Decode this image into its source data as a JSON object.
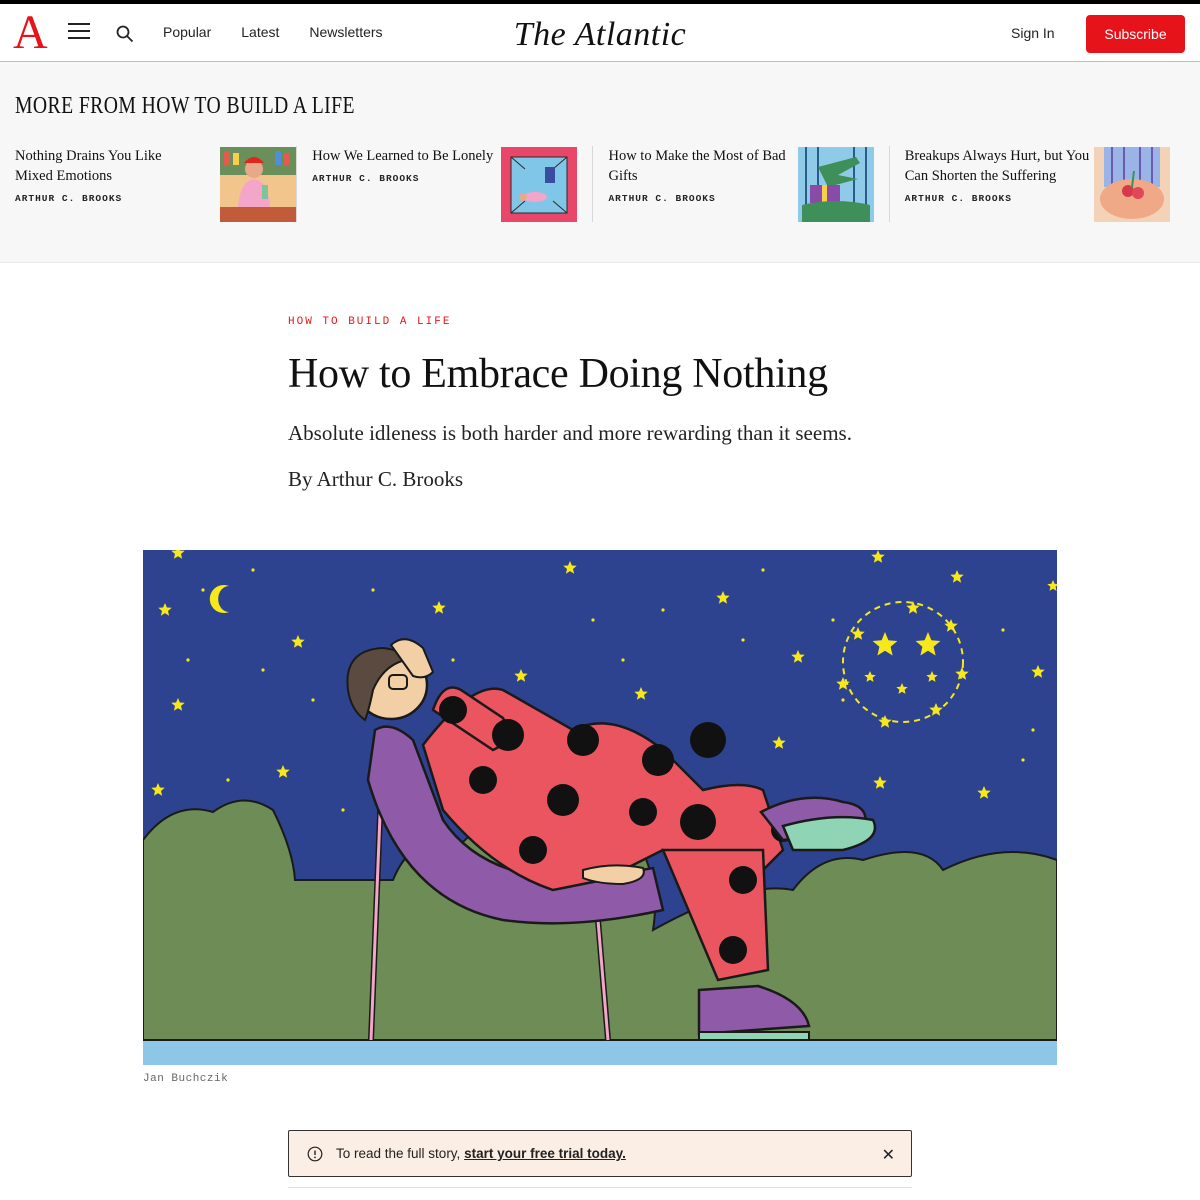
{
  "header": {
    "logo": "A",
    "nav": [
      "Popular",
      "Latest",
      "Newsletters"
    ],
    "masthead": "The Atlantic",
    "sign_in": "Sign In",
    "subscribe": "Subscribe",
    "icons": [
      "menu-icon",
      "search-icon"
    ]
  },
  "more": {
    "title": "MORE FROM HOW TO BUILD A LIFE",
    "cards": [
      {
        "title": "Nothing Drains You Like Mixed Emotions",
        "author": "ARTHUR C. BROOKS"
      },
      {
        "title": "How We Learned to Be Lonely",
        "author": "ARTHUR C. BROOKS"
      },
      {
        "title": "How to Make the Most of Bad Gifts",
        "author": "ARTHUR C. BROOKS"
      },
      {
        "title": "Breakups Always Hurt, but You Can Shorten the Suffering",
        "author": "ARTHUR C. BROOKS"
      }
    ]
  },
  "article": {
    "rubric": "HOW TO BUILD A LIFE",
    "headline": "How to Embrace Doing Nothing",
    "dek": "Absolute idleness is both harder and more rewarding than it seems.",
    "byline": "By Arthur C. Brooks",
    "image_credit": "Jan Buchczik"
  },
  "notice": {
    "text": "To read the full story, ",
    "link": "start your free trial today.",
    "close": "✕"
  },
  "colors": {
    "brand_red": "#e7131a",
    "night_sky": "#2e438f",
    "bush_green": "#6d8c56",
    "star_yellow": "#f7e81b"
  }
}
